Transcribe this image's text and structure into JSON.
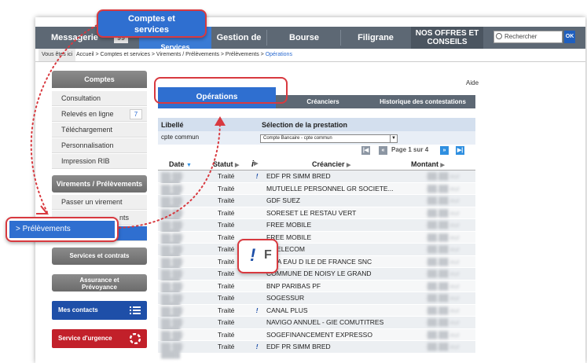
{
  "nav": {
    "messagerie": "Messagerie",
    "messagerie_count": "99",
    "comptes": "Services",
    "budget": "Gestion de budget",
    "bourse": "Bourse",
    "filigrane": "Filigrane",
    "offres": "NOS OFFRES ET CONSEILS",
    "search_placeholder": "Rechercher",
    "ok": "OK"
  },
  "breadcrumb": {
    "label": "Vous êtes ici",
    "path": "Accueil > Comptes et services > Virements / Prélèvements > Prélèvements > ",
    "current": "Opérations"
  },
  "sidebar": {
    "comptes_head": "Comptes",
    "items": [
      "Consultation",
      "Relevés en ligne",
      "Téléchargement",
      "Personnalisation",
      "Impression RIB"
    ],
    "releves_badge": "7",
    "virements_head": "Virements / Prélèvements",
    "virements_items": [
      "Passer un virement",
      "nts"
    ],
    "services_btn": "Services et contrats",
    "assurance_btn": "Assurance et Prévoyance",
    "contacts_btn": "Mes contacts",
    "urgence_btn": "Service d'urgence"
  },
  "main": {
    "aide": "Aide",
    "tabs": [
      "Opérations",
      "Créanciers",
      "Historique des contestations"
    ],
    "libelle_label": "Libellé",
    "libelle_value": "cpte commun",
    "selection_label": "Sélection de la prestation",
    "selection_value": "Compte Bancaire - cpte commun",
    "pager_text": "Page 1 sur 4",
    "columns": [
      "Date",
      "Statut",
      "Créancier",
      "Montant"
    ]
  },
  "rows": [
    {
      "statut": "Traité",
      "info": "!",
      "creancier": "EDF PR SIMM BRED"
    },
    {
      "statut": "Traité",
      "info": "",
      "creancier": "MUTUELLE PERSONNEL GR SOCIETE..."
    },
    {
      "statut": "Traité",
      "info": "",
      "creancier": "GDF SUEZ"
    },
    {
      "statut": "Traité",
      "info": "",
      "creancier": "SORESET LE RESTAU VERT"
    },
    {
      "statut": "Traité",
      "info": "",
      "creancier": "FREE MOBILE"
    },
    {
      "statut": "Traité",
      "info": "",
      "creancier": "FREE MOBILE"
    },
    {
      "statut": "Traité",
      "info": "",
      "creancier": "E TELECOM"
    },
    {
      "statut": "Traité",
      "info": "",
      "creancier": "OLIA EAU D ILE DE FRANCE SNC"
    },
    {
      "statut": "Traité",
      "info": "",
      "creancier": "COMMUNE DE NOISY LE GRAND"
    },
    {
      "statut": "Traité",
      "info": "",
      "creancier": "BNP PARIBAS PF"
    },
    {
      "statut": "Traité",
      "info": "",
      "creancier": "SOGESSUR"
    },
    {
      "statut": "Traité",
      "info": "!",
      "creancier": "CANAL PLUS"
    },
    {
      "statut": "Traité",
      "info": "",
      "creancier": "NAVIGO ANNUEL - GIE COMUTITRES"
    },
    {
      "statut": "Traité",
      "info": "",
      "creancier": "SOGEFINANCEMENT EXPRESSO"
    },
    {
      "statut": "Traité",
      "info": "!",
      "creancier": "EDF PR SIMM BRED"
    }
  ],
  "callouts": {
    "comptes_line1": "Comptes et",
    "comptes_line2": "services",
    "prelevements": "> Prélèvements",
    "info_mark": "!",
    "info_letter": "F"
  },
  "colors": {
    "accent_blue": "#2f6fd0",
    "highlight_red": "#d8393f",
    "nav_grey": "#5d6874"
  }
}
